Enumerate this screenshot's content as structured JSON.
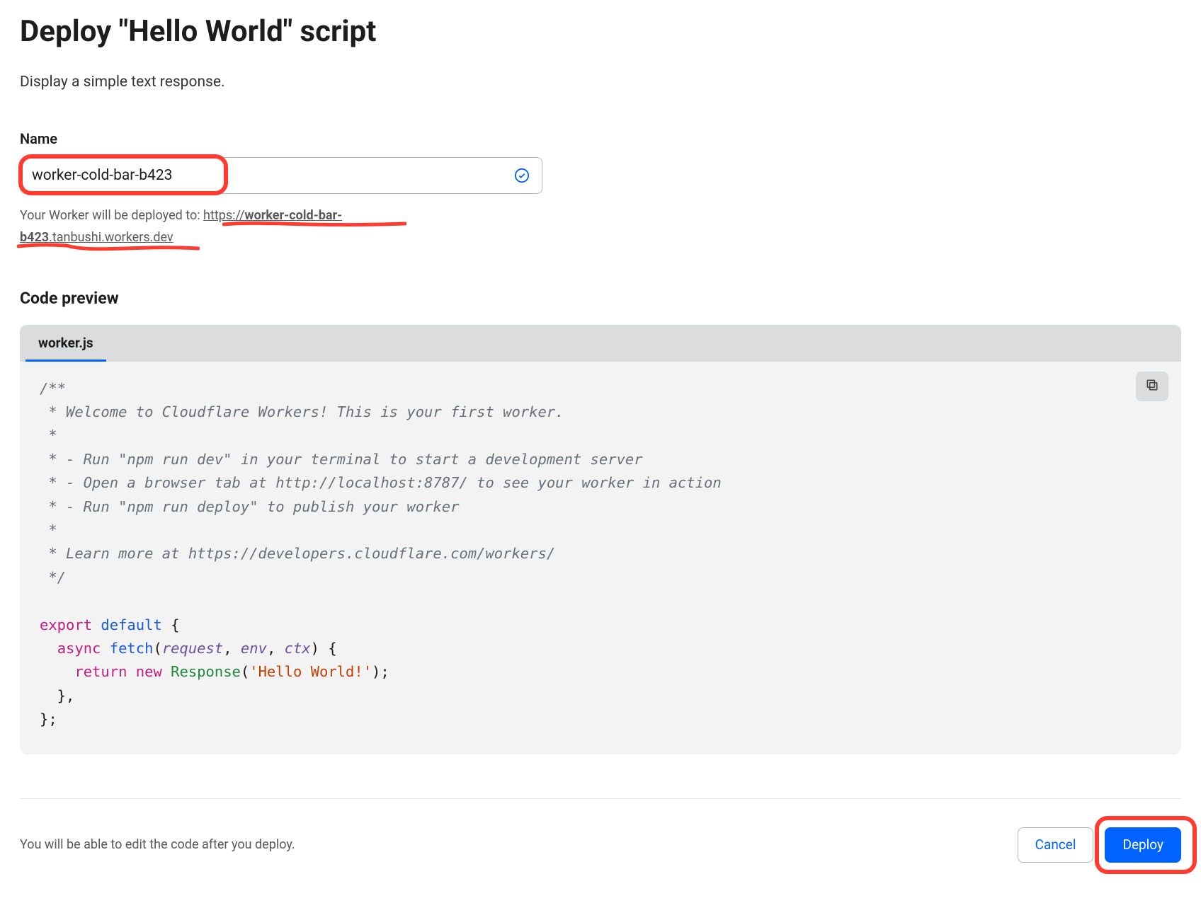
{
  "page": {
    "title": "Deploy \"Hello World\" script",
    "subtitle": "Display a simple text response."
  },
  "nameField": {
    "label": "Name",
    "value": "worker-cold-bar-b423",
    "deployedPrefix": "Your Worker will be deployed to: ",
    "urlPrefix": "https://",
    "urlBold": "worker-cold-bar-b423",
    "urlSuffix": ".tanbushi.workers.dev"
  },
  "codePreview": {
    "sectionTitle": "Code preview",
    "tab": "worker.js"
  },
  "code": {
    "c1": "/**",
    "c2": " * Welcome to Cloudflare Workers! This is your first worker.",
    "c3": " *",
    "c4": " * - Run \"npm run dev\" in your terminal to start a development server",
    "c5": " * - Open a browser tab at http://localhost:8787/ to see your worker in action",
    "c6": " * - Run \"npm run deploy\" to publish your worker",
    "c7": " *",
    "c8": " * Learn more at https://developers.cloudflare.com/workers/",
    "c9": " */",
    "kw_export": "export",
    "kw_default": "default",
    "brace_open": " {",
    "kw_async": "async",
    "fn_fetch": "fetch",
    "paren_open": "(",
    "param_request": "request",
    "comma1": ", ",
    "param_env": "env",
    "comma2": ", ",
    "param_ctx": "ctx",
    "paren_close": ")",
    "fn_body_open": " {",
    "kw_return": "return",
    "kw_new": "new",
    "class_response": "Response",
    "paren_open2": "(",
    "str_hello": "'Hello World!'",
    "paren_close2": ")",
    "semi": ";",
    "close_inner": "  },",
    "close_outer": "};"
  },
  "footer": {
    "note": "You will be able to edit the code after you deploy.",
    "cancel": "Cancel",
    "deploy": "Deploy"
  }
}
